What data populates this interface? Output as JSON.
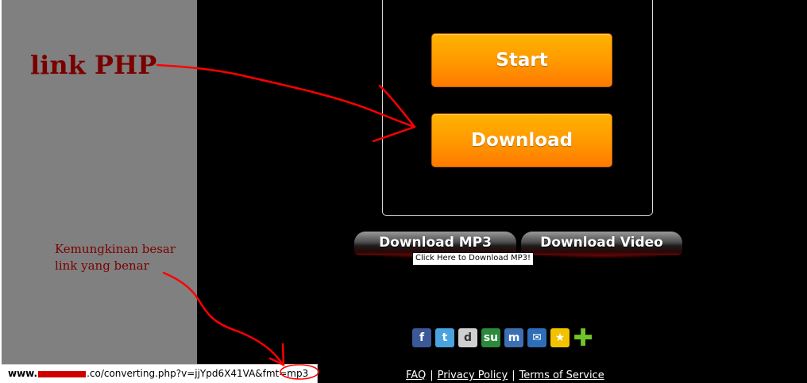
{
  "annotations": {
    "php_label": "link PHP",
    "note_line1": "Kemungkinan besar",
    "note_line2": "link yang benar"
  },
  "buttons": {
    "start": "Start",
    "download": "Download",
    "download_mp3": "Download MP3",
    "download_video": "Download Video"
  },
  "tooltip": "Click Here to Download MP3!",
  "social": [
    {
      "name": "facebook-icon",
      "glyph": "f"
    },
    {
      "name": "twitter-icon",
      "glyph": "t"
    },
    {
      "name": "digg-icon",
      "glyph": "d"
    },
    {
      "name": "stumbleupon-icon",
      "glyph": "su"
    },
    {
      "name": "myspace-icon",
      "glyph": "m"
    },
    {
      "name": "email-icon",
      "glyph": "✉"
    },
    {
      "name": "favorite-icon",
      "glyph": "★"
    },
    {
      "name": "add-icon",
      "glyph": "✚"
    }
  ],
  "footer": {
    "faq": "FAQ",
    "privacy": "Privacy Policy",
    "terms": "Terms of Service",
    "separator": "|"
  },
  "status_bar": {
    "url_prefix": "www.",
    "url_rest": ".co/converting.php?v=jjYpd6X41VA&fmt=mp3"
  },
  "colors": {
    "accent_orange": "#ff9a00",
    "annotation_red": "#7a0000",
    "arrow_red": "#ff0000",
    "sidebar_gray": "#808080"
  }
}
